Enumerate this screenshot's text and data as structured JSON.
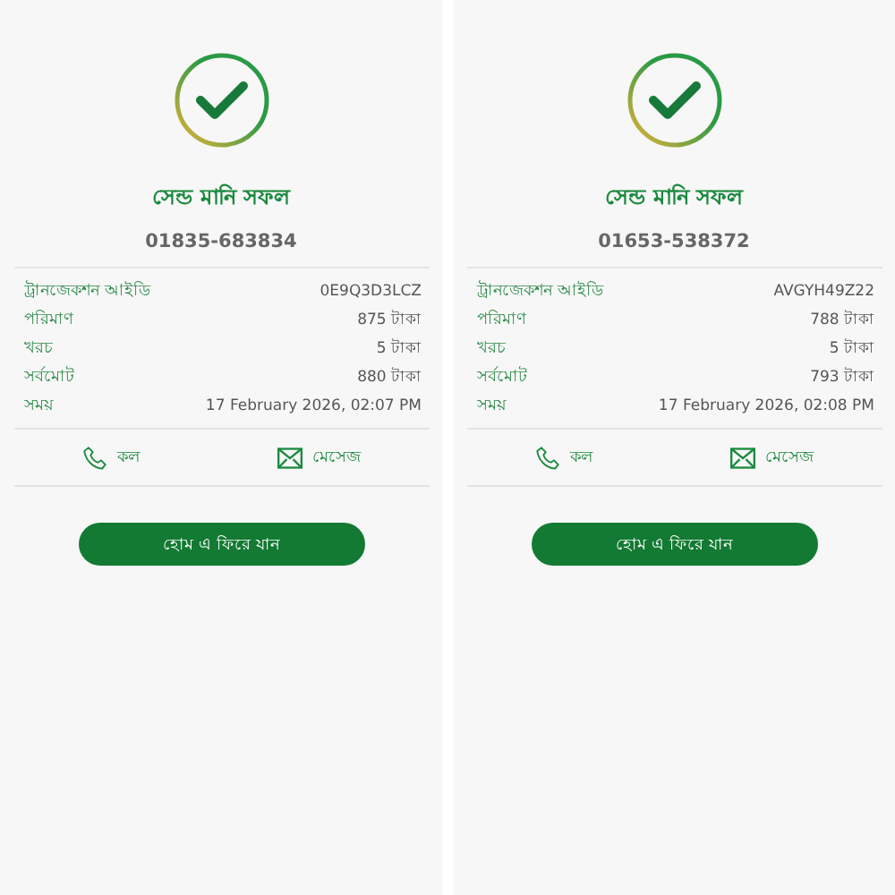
{
  "panels": [
    {
      "title": "সেন্ড মানি সফল",
      "phone": "01835-683834",
      "details": [
        {
          "label": "ট্রানজেকশন আইডি",
          "value": "0E9Q3D3LCZ"
        },
        {
          "label": "পরিমাণ",
          "value": "875 টাকা"
        },
        {
          "label": "খরচ",
          "value": "5 টাকা"
        },
        {
          "label": "সর্বমোট",
          "value": "880 টাকা"
        },
        {
          "label": "সময়",
          "value": "17 February 2026, 02:07 PM"
        }
      ],
      "actions": [
        {
          "kind": "call",
          "label": "কল"
        },
        {
          "kind": "message",
          "label": "মেসেজ"
        }
      ],
      "button": "হোম এ ফিরে যান"
    },
    {
      "title": "সেন্ড মানি সফল",
      "phone": "01653-538372",
      "details": [
        {
          "label": "ট্রানজেকশন আইডি",
          "value": "AVGYH49Z22"
        },
        {
          "label": "পরিমাণ",
          "value": "788 টাকা"
        },
        {
          "label": "খরচ",
          "value": "5 টাকা"
        },
        {
          "label": "সর্বমোট",
          "value": "793 টাকা"
        },
        {
          "label": "সময়",
          "value": "17 February 2026, 02:08 PM"
        }
      ],
      "actions": [
        {
          "kind": "call",
          "label": "কল"
        },
        {
          "kind": "message",
          "label": "মেসেজ"
        }
      ],
      "button": "হোম এ ফিরে যান"
    }
  ]
}
